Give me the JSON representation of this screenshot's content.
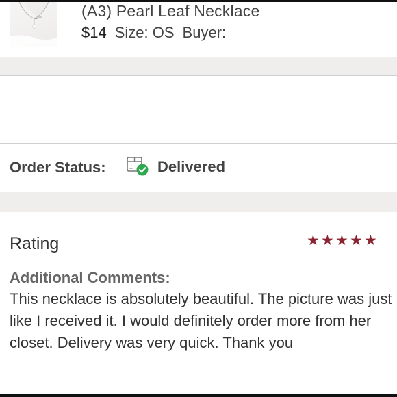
{
  "product": {
    "title": "(A3) Pearl Leaf Necklace",
    "price": "$14",
    "size": "Size: OS",
    "buyer_label": "Buyer:"
  },
  "order_status": {
    "label": "Order Status:",
    "value": "Delivered",
    "icon": "package-delivered-icon",
    "icon_check_color": "#2fa84f"
  },
  "rating": {
    "title": "Rating",
    "stars": 5,
    "max_stars": 5,
    "star_color": "#8b2331",
    "comments_label": "Additional Comments:",
    "comments": "This necklace is absolutely beautiful. The picture was just like I received it. I would definitely order more from her closet. Delivery was very quick. Thank you"
  }
}
